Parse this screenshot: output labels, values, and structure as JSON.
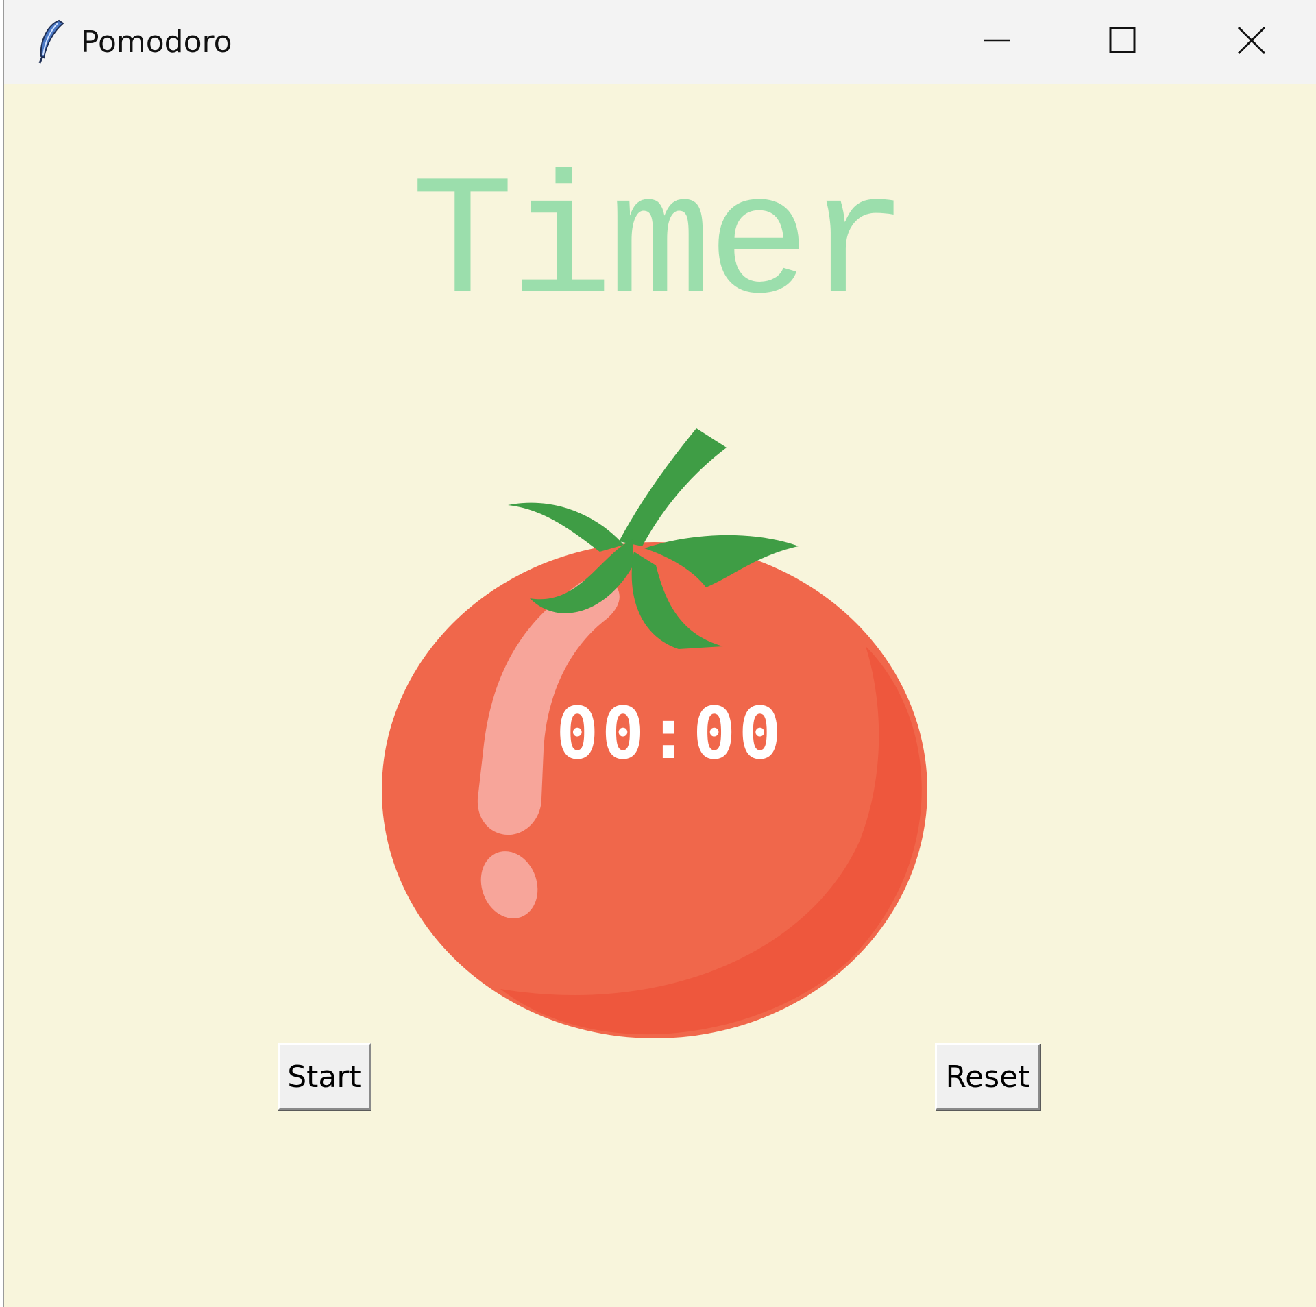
{
  "window": {
    "title": "Pomodoro",
    "app_icon": "feather-icon",
    "controls": [
      "minimize-icon",
      "maximize-icon",
      "close-icon"
    ]
  },
  "main": {
    "heading": "Timer",
    "timer_display": "00:00",
    "start_label": "Start",
    "reset_label": "Reset"
  },
  "colors": {
    "background": "#f8f5dc",
    "heading": "#9bdeac",
    "tomato": "#f0674b",
    "tomato_shade": "#ee573d",
    "leaf": "#3f9d45",
    "timer_text": "#ffffff"
  }
}
